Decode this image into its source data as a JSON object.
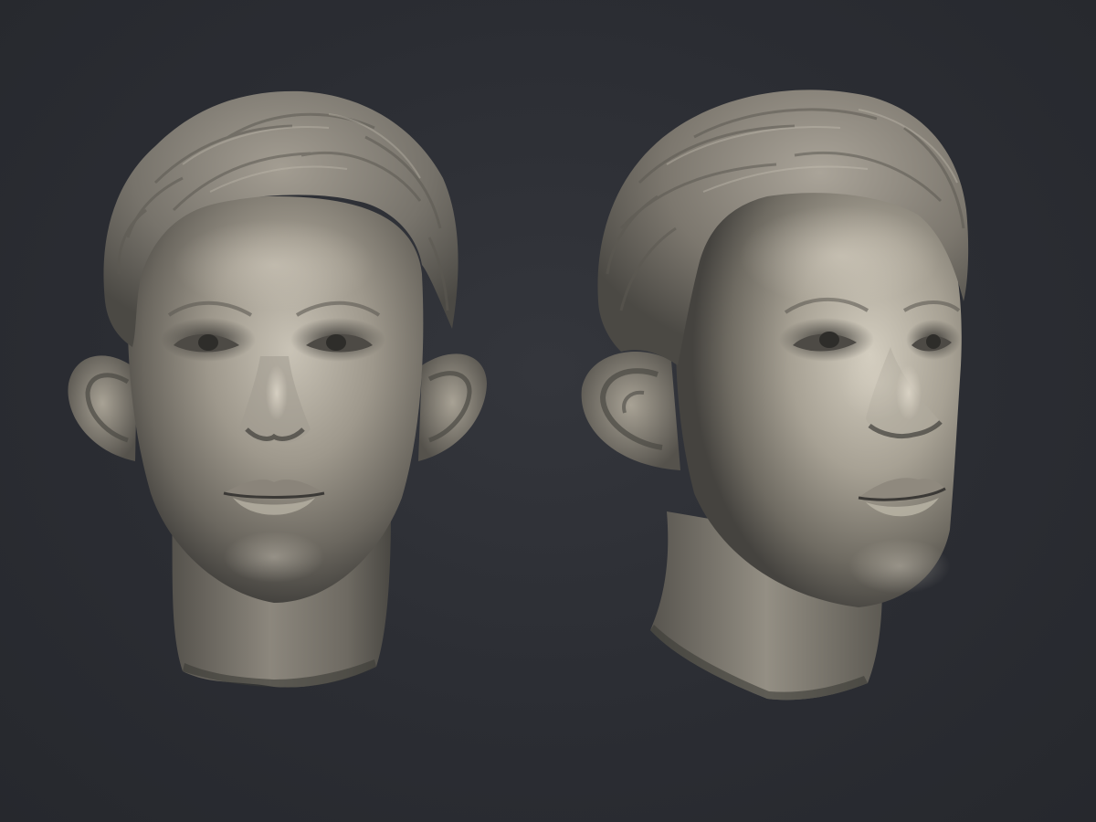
{
  "scene": {
    "background_color": "#2b2d33",
    "material_color": "#8f8a80",
    "highlight_color": "#d6d0c4",
    "shadow_color": "#3a3936"
  },
  "views": [
    {
      "name": "front-view"
    },
    {
      "name": "three-quarter-view"
    }
  ]
}
